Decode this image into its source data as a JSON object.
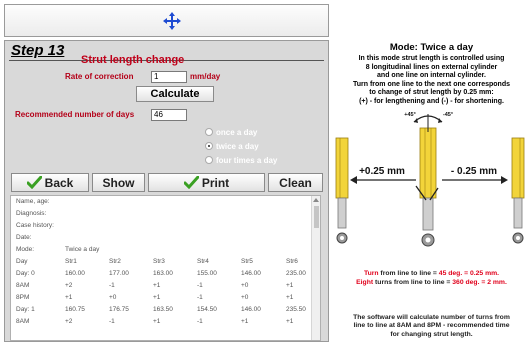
{
  "step": {
    "title": "Step 13",
    "section_title": "Strut length change",
    "rate_label": "Rate of correction",
    "rate_value": "1",
    "rate_unit": "mm/day",
    "calculate_label": "Calculate",
    "days_label": "Recommended number of days",
    "days_value": "46",
    "options": [
      {
        "label": "once a day",
        "selected": false
      },
      {
        "label": "twice a day",
        "selected": true
      },
      {
        "label": "four times a day",
        "selected": false
      }
    ]
  },
  "buttons": {
    "back": "Back",
    "show": "Show",
    "print": "Print",
    "clean": "Clean"
  },
  "log": {
    "fields": [
      {
        "label": "Name, age:",
        "value": ""
      },
      {
        "label": "Diagnosis:",
        "value": ""
      },
      {
        "label": "Case history:",
        "value": ""
      },
      {
        "label": "Date:",
        "value": ""
      },
      {
        "label": "Mode:",
        "value": "Twice a day"
      }
    ],
    "columns": [
      "Day",
      "Str1",
      "Str2",
      "Str3",
      "Str4",
      "Str5",
      "Str6"
    ],
    "rows": [
      [
        "Day: 0",
        "160.00",
        "177.00",
        "163.00",
        "155.00",
        "146.00",
        "235.00"
      ],
      [
        "8AM",
        "+2",
        "-1",
        "+1",
        "-1",
        "+0",
        "+1"
      ],
      [
        "8PM",
        "+1",
        "+0",
        "+1",
        "-1",
        "+0",
        "+1"
      ],
      [
        "Day: 1",
        "160.75",
        "176.75",
        "163.50",
        "154.50",
        "146.00",
        "235.50"
      ],
      [
        "8AM",
        "+2",
        "-1",
        "+1",
        "-1",
        "+1",
        "+1"
      ]
    ]
  },
  "info": {
    "mode_title": "Mode: Twice a day",
    "description": [
      "In this mode strut length is controlled using",
      "8 longitudinal lines on external cylinder",
      "and one line on internal cylinder.",
      "Turn from one line to the next one corresponds",
      "to change of strut length by 0.25 mm:",
      "(+) - for lengthening and  (-) - for shortening."
    ],
    "angle_plus": "+45°",
    "angle_minus": "-45°",
    "lengthen_label": "+0.25 mm",
    "shorten_label": "- 0.25 mm",
    "turn_note_word": "Turn",
    "turn_note": " from line to line = ",
    "turn_note_value": "45 deg. = 0.25 mm.",
    "eight_note_word": "Eight",
    "eight_note": " turns from line to line = ",
    "eight_note_value": "360 deg. = 2 mm.",
    "software_note": [
      "The software will calculate number of turns from",
      "line to line at 8AM and 8PM - recommended time",
      "for changing strut length."
    ]
  },
  "colors": {
    "accent_red": "#c0001a",
    "panel_gray": "#d9d9d9",
    "check_green": "#3aa023",
    "strut_yellow": "#f2d43a"
  }
}
